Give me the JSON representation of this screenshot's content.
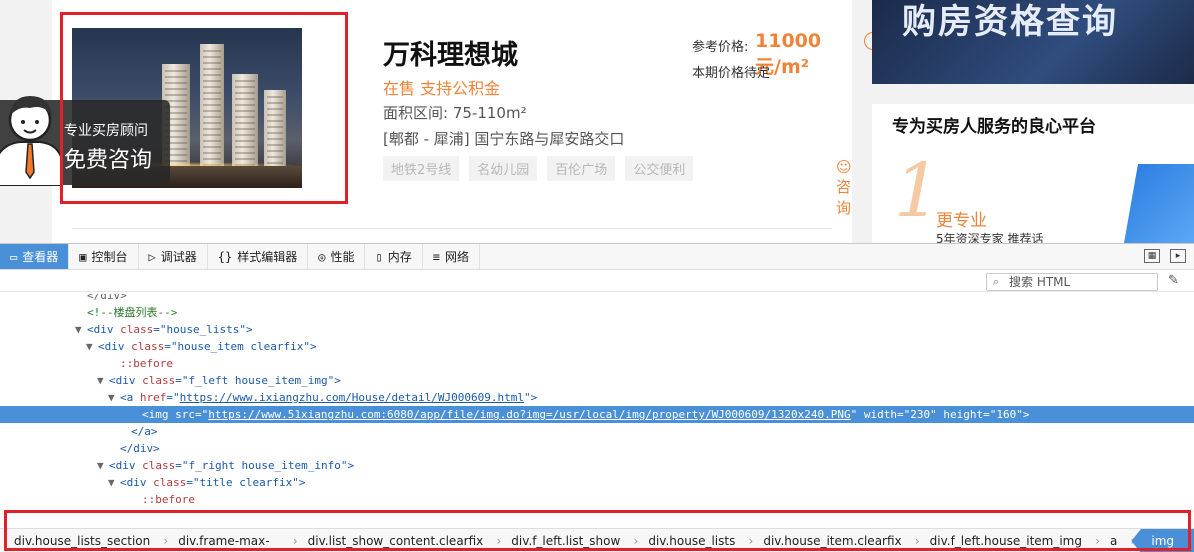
{
  "listing": {
    "consult_line1": "专业买房顾问",
    "consult_line2": "免费咨询",
    "title": "万科理想城",
    "status": "在售 支持公积金",
    "area": "面积区间: 75-110m²",
    "address": "[郫都 - 犀浦] 国宁东路与犀安路交口",
    "tags": [
      "地铁2号线",
      "名幼儿园",
      "百伦广场",
      "公交便利"
    ],
    "price_label": "参考价格:",
    "price_value": "11000元/m²",
    "price_note": "本期价格待定",
    "ask": "咨询"
  },
  "sidebar": {
    "banner_text": "购房资格查询",
    "promo_title": "专为买房人服务的良心平台",
    "promo_big": "1",
    "promo_sub1": "更专业",
    "promo_sub2": "5年资深专家 推荐话"
  },
  "devtools": {
    "tabs": [
      {
        "label": "查看器",
        "icon": "inspector-icon"
      },
      {
        "label": "控制台",
        "icon": "console-icon"
      },
      {
        "label": "调试器",
        "icon": "debugger-icon"
      },
      {
        "label": "样式编辑器",
        "icon": "style-editor-icon"
      },
      {
        "label": "性能",
        "icon": "performance-icon"
      },
      {
        "label": "内存",
        "icon": "memory-icon"
      },
      {
        "label": "网络",
        "icon": "network-icon"
      }
    ],
    "search_placeholder": "搜索 HTML",
    "tree": [
      {
        "indent": 7,
        "twisty": "",
        "parts": [
          [
            "tw",
            "</div>"
          ]
        ]
      },
      {
        "indent": 7,
        "twisty": "",
        "parts": [
          [
            "cmt",
            "<!--楼盘列表-->"
          ]
        ]
      },
      {
        "indent": 7,
        "twisty": "▼",
        "parts": [
          [
            "tag-n",
            "<div "
          ],
          [
            "attr",
            "class"
          ],
          [
            "tag-n",
            "="
          ],
          [
            "val",
            "\"house_lists\""
          ],
          [
            "tag-n",
            ">"
          ]
        ]
      },
      {
        "indent": 8,
        "twisty": "▼",
        "parts": [
          [
            "tag-n",
            "<div "
          ],
          [
            "attr",
            "class"
          ],
          [
            "tag-n",
            "="
          ],
          [
            "val",
            "\"house_item clearfix\""
          ],
          [
            "tag-n",
            ">"
          ]
        ]
      },
      {
        "indent": 10,
        "twisty": "",
        "parts": [
          [
            "pseudo",
            "::before"
          ]
        ]
      },
      {
        "indent": 9,
        "twisty": "▼",
        "parts": [
          [
            "tag-n",
            "<div "
          ],
          [
            "attr",
            "class"
          ],
          [
            "tag-n",
            "="
          ],
          [
            "val",
            "\"f_left house_item_img\""
          ],
          [
            "tag-n",
            ">"
          ]
        ]
      },
      {
        "indent": 10,
        "twisty": "▼",
        "parts": [
          [
            "tag-n",
            "<a "
          ],
          [
            "attr",
            "href"
          ],
          [
            "tag-n",
            "=\""
          ],
          [
            "lnk",
            "https://www.ixiangzhu.com/House/detail/WJ000609.html"
          ],
          [
            "tag-n",
            "\">"
          ]
        ]
      },
      {
        "indent": 12,
        "twisty": "",
        "sel": true,
        "parts": [
          [
            "tag-n",
            "<img "
          ],
          [
            "attr",
            "src"
          ],
          [
            "tag-n",
            "=\""
          ],
          [
            "lnk",
            "https://www.51xiangzhu.com:6080/app/file/img.do?img=/usr/local/img/property/WJ000609/1320x240.PNG"
          ],
          [
            "tag-n",
            "\" "
          ],
          [
            "attr",
            "width"
          ],
          [
            "tag-n",
            "="
          ],
          [
            "val",
            "\"230\""
          ],
          [
            "tag-n",
            " "
          ],
          [
            "attr",
            "height"
          ],
          [
            "tag-n",
            "="
          ],
          [
            "val",
            "\"160\""
          ],
          [
            "tag-n",
            ">"
          ]
        ]
      },
      {
        "indent": 11,
        "twisty": "",
        "parts": [
          [
            "tag-n",
            "</a>"
          ]
        ]
      },
      {
        "indent": 10,
        "twisty": "",
        "parts": [
          [
            "tag-n",
            "</div>"
          ]
        ]
      },
      {
        "indent": 9,
        "twisty": "▼",
        "parts": [
          [
            "tag-n",
            "<div "
          ],
          [
            "attr",
            "class"
          ],
          [
            "tag-n",
            "="
          ],
          [
            "val",
            "\"f_right house_item_info\""
          ],
          [
            "tag-n",
            ">"
          ]
        ]
      },
      {
        "indent": 10,
        "twisty": "▼",
        "parts": [
          [
            "tag-n",
            "<div "
          ],
          [
            "attr",
            "class"
          ],
          [
            "tag-n",
            "="
          ],
          [
            "val",
            "\"title clearfix\""
          ],
          [
            "tag-n",
            ">"
          ]
        ]
      },
      {
        "indent": 12,
        "twisty": "",
        "parts": [
          [
            "pseudo",
            "::before"
          ]
        ]
      }
    ],
    "breadcrumbs": [
      "div.house_lists_section",
      "div.frame-max-width",
      "div.list_show_content.clearfix",
      "div.f_left.list_show",
      "div.house_lists",
      "div.house_item.clearfix",
      "div.f_left.house_item_img",
      "a",
      "img"
    ]
  },
  "colors": {
    "accent_orange": "#f0833a",
    "selection_blue": "#4a90d9",
    "highlight_red": "#e0202a"
  }
}
